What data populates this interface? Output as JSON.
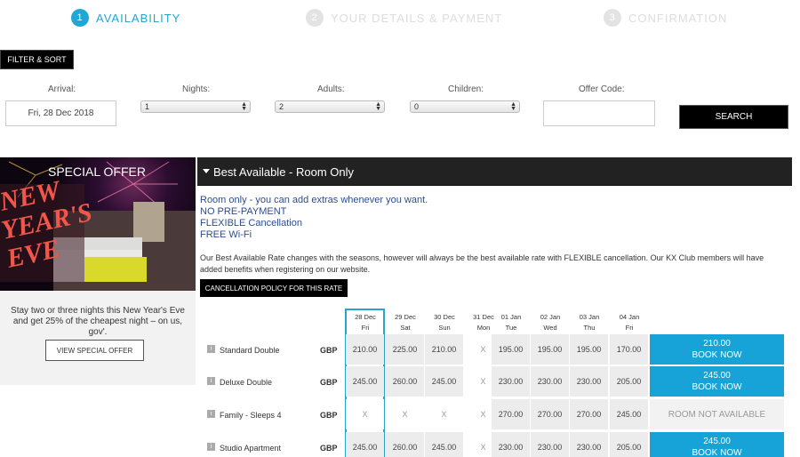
{
  "steps": [
    {
      "num": "1",
      "label": "AVAILABILITY"
    },
    {
      "num": "2",
      "label": "YOUR DETAILS & PAYMENT"
    },
    {
      "num": "3",
      "label": "CONFIRMATION"
    }
  ],
  "filter": {
    "toggle_label": "FILTER & SORT",
    "arrival_label": "Arrival:",
    "arrival_value": "Fri, 28 Dec 2018",
    "nights_label": "Nights:",
    "nights_value": "1",
    "adults_label": "Adults:",
    "adults_value": "2",
    "children_label": "Children:",
    "children_value": "0",
    "offer_label": "Offer Code:",
    "offer_value": "",
    "search_label": "SEARCH"
  },
  "special": {
    "title": "SPECIAL OFFER",
    "text": "Stay two or three nights this New Year's Eve and get 25% of the cheapest night – on us, gov'.",
    "button": "VIEW SPECIAL OFFER"
  },
  "rate": {
    "title": "Best Available - Room Only",
    "desc": [
      "Room only - you can add extras whenever you want.",
      "NO PRE-PAYMENT",
      "FLEXIBLE Cancellation",
      "FREE Wi-Fi"
    ],
    "note": "Our Best Available Rate changes with the seasons, however will always be the best available rate with FLEXIBLE cancellation. Our KX Club members will have added benefits when registering on our website.",
    "cancel_btn": "CANCELLATION POLICY FOR THIS RATE"
  },
  "dates": [
    {
      "date": "28 Dec",
      "day": "Fri"
    },
    {
      "date": "29 Dec",
      "day": "Sat"
    },
    {
      "date": "30 Dec",
      "day": "Sun"
    },
    {
      "date": "31 Dec",
      "day": "Mon"
    },
    {
      "date": "01 Jan",
      "day": "Tue"
    },
    {
      "date": "02 Jan",
      "day": "Wed"
    },
    {
      "date": "03 Jan",
      "day": "Thu"
    },
    {
      "date": "04 Jan",
      "day": "Fri"
    }
  ],
  "rooms": [
    {
      "name": "Standard Double",
      "currency": "GBP",
      "prices": [
        "210.00",
        "225.00",
        "210.00",
        "X",
        "195.00",
        "195.00",
        "195.00",
        "170.00"
      ],
      "book_price": "210.00",
      "book_label": "BOOK NOW",
      "available": true
    },
    {
      "name": "Deluxe Double",
      "currency": "GBP",
      "prices": [
        "245.00",
        "260.00",
        "245.00",
        "X",
        "230.00",
        "230.00",
        "230.00",
        "205.00"
      ],
      "book_price": "245.00",
      "book_label": "BOOK NOW",
      "available": true
    },
    {
      "name": "Family - Sleeps 4",
      "currency": "GBP",
      "prices": [
        "X",
        "X",
        "X",
        "X",
        "270.00",
        "270.00",
        "270.00",
        "245.00"
      ],
      "na_label": "ROOM NOT AVAILABLE",
      "available": false
    },
    {
      "name": "Studio Apartment",
      "currency": "GBP",
      "prices": [
        "245.00",
        "260.00",
        "245.00",
        "X",
        "230.00",
        "230.00",
        "230.00",
        "205.00"
      ],
      "book_price": "245.00",
      "book_label": "BOOK NOW",
      "available": true
    }
  ],
  "colors": {
    "accent": "#1ea7d7",
    "book": "#17a3d8"
  }
}
